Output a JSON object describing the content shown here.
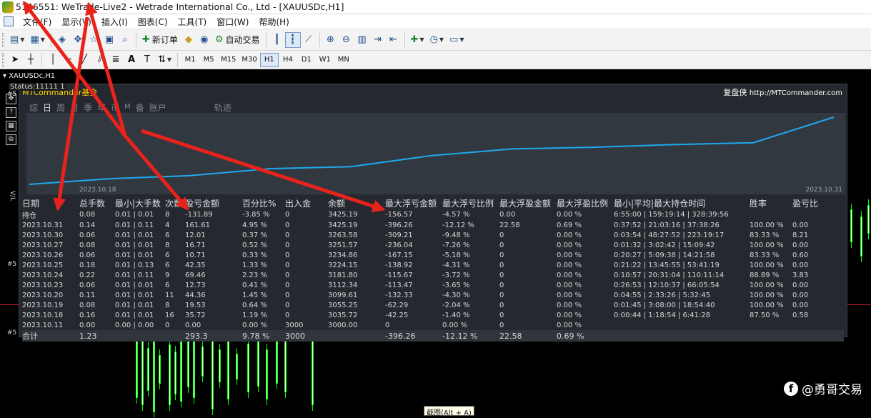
{
  "window": {
    "title": "5146551: WeTrade-Live2 - Wetrade International Co., Ltd - [XAUUSDc,H1]"
  },
  "menu": {
    "items": [
      "文件(F)",
      "显示(V)",
      "插入(I)",
      "图表(C)",
      "工具(T)",
      "窗口(W)",
      "帮助(H)"
    ]
  },
  "toolbar": {
    "new_order": "新订单",
    "auto_trading": "自动交易",
    "timeframes": [
      "M1",
      "M5",
      "M15",
      "M30",
      "H1",
      "H4",
      "D1",
      "W1",
      "MN"
    ],
    "active_timeframe": "H1",
    "text_tool": "A"
  },
  "chart": {
    "tab_label": "XAUUSDc,H1",
    "side_marks": [
      "#5",
      "#5",
      "#5",
      "#5"
    ],
    "vertical_text": "V/L"
  },
  "panel": {
    "status": "Status:11111 1",
    "title": "MTCommander基金",
    "brand": "复盘侠",
    "brand_url": "http://MTCommander.com",
    "tabs": [
      "综",
      "日",
      "周",
      "月",
      "季",
      "年",
      "币",
      "M",
      "备",
      "账户",
      "轨迹"
    ],
    "active_tab": "日",
    "chart_start_date": "2023.10.18",
    "chart_end_date": "2023.10.31",
    "equity_curve": [
      3000.0,
      3035.72,
      3055.25,
      3099.61,
      3112.34,
      3181.8,
      3224.15,
      3234.86,
      3251.57,
      3263.58,
      3425.19
    ],
    "columns": [
      "日期",
      "总手数",
      "最小|大手数",
      "次数",
      "盈亏金额",
      "百分比%",
      "出入金",
      "余额",
      "最大浮亏金额",
      "最大浮亏比例",
      "最大浮盈金额",
      "最大浮盈比例",
      "最小|平均|最大持仓时间",
      "胜率",
      "盈亏比"
    ],
    "rows": [
      {
        "cells": [
          "持仓",
          "0.08",
          "0.01 | 0.01",
          "8",
          "-131.89",
          "-3.85 %",
          "0",
          "3425.19",
          "-156.57",
          "-4.57 %",
          "0.00",
          "0.00 %",
          "6:55:00 | 159:19:14 | 328:39:56",
          "",
          ""
        ],
        "tone": "pos"
      },
      {
        "cells": [
          "2023.10.31",
          "0.14",
          "0.01 | 0.11",
          "4",
          "161.61",
          "4.95 %",
          "0",
          "3425.19",
          "-396.26",
          "-12.12 %",
          "22.58",
          "0.69 %",
          "0:37:52 | 21:03:16 | 37:38:26",
          "100.00 %",
          "0.00"
        ],
        "tone": "neg"
      },
      {
        "cells": [
          "2023.10.30",
          "0.06",
          "0.01 | 0.01",
          "6",
          "12.01",
          "0.37 %",
          "0",
          "3263.58",
          "-309.21",
          "-9.48 %",
          "0",
          "0.00 %",
          "0:03:54 | 48:27:52 | 223:19:17",
          "83.33 %",
          "8.21"
        ],
        "tone": "neg"
      },
      {
        "cells": [
          "2023.10.27",
          "0.08",
          "0.01 | 0.01",
          "8",
          "16.71",
          "0.52 %",
          "0",
          "3251.57",
          "-236.04",
          "-7.26 %",
          "0",
          "0.00 %",
          "0:01:32 | 3:02:42 | 15:09:42",
          "100.00 %",
          "0.00"
        ],
        "tone": "neg"
      },
      {
        "cells": [
          "2023.10.26",
          "0.06",
          "0.01 | 0.01",
          "6",
          "10.71",
          "0.33 %",
          "0",
          "3234.86",
          "-167.15",
          "-5.18 %",
          "0",
          "0.00 %",
          "0:20:27 | 5:09:38 | 14:21:58",
          "83.33 %",
          "0.60"
        ],
        "tone": "neg"
      },
      {
        "cells": [
          "2023.10.25",
          "0.18",
          "0.01 | 0.13",
          "6",
          "42.35",
          "1.33 %",
          "0",
          "3224.15",
          "-138.92",
          "-4.31 %",
          "0",
          "0.00 %",
          "0:21:22 | 13:45:55 | 53:41:19",
          "100.00 %",
          "0.00"
        ],
        "tone": "neg"
      },
      {
        "cells": [
          "2023.10.24",
          "0.22",
          "0.01 | 0.11",
          "9",
          "69.46",
          "2.23 %",
          "0",
          "3181.80",
          "-115.67",
          "-3.72 %",
          "0",
          "0.00 %",
          "0:10:57 | 20:31:04 | 110:11:14",
          "88.89 %",
          "3.83"
        ],
        "tone": "neg"
      },
      {
        "cells": [
          "2023.10.23",
          "0.06",
          "0.01 | 0.01",
          "6",
          "12.73",
          "0.41 %",
          "0",
          "3112.34",
          "-113.47",
          "-3.65 %",
          "0",
          "0.00 %",
          "0:26:53 | 12:10:37 | 66:05:54",
          "100.00 %",
          "0.00"
        ],
        "tone": "neg"
      },
      {
        "cells": [
          "2023.10.20",
          "0.11",
          "0.01 | 0.01",
          "11",
          "44.36",
          "1.45 %",
          "0",
          "3099.61",
          "-132.33",
          "-4.30 %",
          "0",
          "0.00 %",
          "0:04:55 | 2:33:26 | 5:32:45",
          "100.00 %",
          "0.00"
        ],
        "tone": "neg"
      },
      {
        "cells": [
          "2023.10.19",
          "0.08",
          "0.01 | 0.01",
          "8",
          "19.53",
          "0.64 %",
          "0",
          "3055.25",
          "-62.29",
          "-2.04 %",
          "0",
          "0.00 %",
          "0:01:45 | 3:08:00 | 18:54:40",
          "100.00 %",
          "0.00"
        ],
        "tone": "neg"
      },
      {
        "cells": [
          "2023.10.18",
          "0.16",
          "0.01 | 0.01",
          "16",
          "35.72",
          "1.19 %",
          "0",
          "3035.72",
          "-42.25",
          "-1.40 %",
          "0",
          "0.00 %",
          "0:00:44 | 1:18:54 | 6:41:28",
          "87.50 %",
          "0.58"
        ],
        "tone": "neg"
      },
      {
        "cells": [
          "2023.10.11",
          "0.00",
          "0.00 | 0.00",
          "0",
          "0.00",
          "0.00 %",
          "3000",
          "3000.00",
          "0",
          "0.00 %",
          "0",
          "0.00 %",
          "",
          "",
          ""
        ],
        "tone": "neu"
      }
    ],
    "total": {
      "cells": [
        "合计",
        "1.23",
        "",
        "",
        "293.3",
        "9.78 %",
        "3000",
        "",
        "-396.26",
        "-12.12 %",
        "22.58",
        "0.69 %",
        "",
        "",
        ""
      ]
    }
  },
  "screenshot_tip": "截图(Alt + A)",
  "watermark": "@勇哥交易",
  "colors": {
    "positive": "#2ff06a",
    "negative": "#ff3535",
    "curve": "#1fa9ee",
    "title": "#ffd400",
    "arrow": "#e8231b"
  }
}
